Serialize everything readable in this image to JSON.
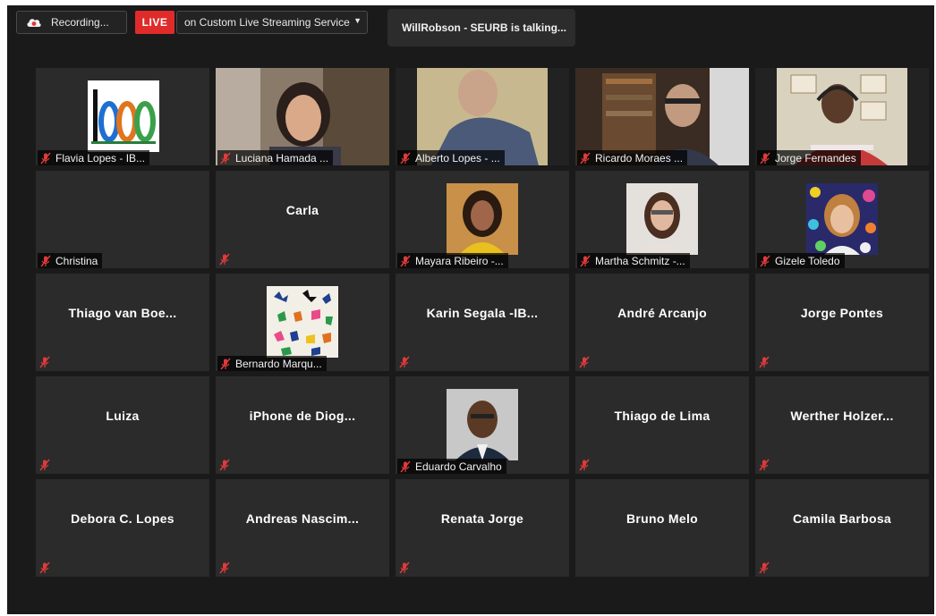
{
  "topbar": {
    "recording_label": "Recording...",
    "live_label": "LIVE",
    "stream_label": "on Custom Live Streaming Service",
    "talking_label": "WillRobson - SEURB is talking..."
  },
  "colors": {
    "live": "#e02b2b",
    "mic_muted": "#e03a3a",
    "tile_bg": "#2b2b2b",
    "window_bg": "#1a1a1a"
  },
  "participants": [
    {
      "name": "Flavia Lopes - IB...",
      "kind": "logo"
    },
    {
      "name": "Luciana Hamada ...",
      "kind": "video"
    },
    {
      "name": "Alberto Lopes  - ...",
      "kind": "video"
    },
    {
      "name": "Ricardo Moraes ...",
      "kind": "video"
    },
    {
      "name": "Jorge Fernandes",
      "kind": "video"
    },
    {
      "name": "Christina",
      "kind": "blank"
    },
    {
      "name": "Carla",
      "kind": "center"
    },
    {
      "name": "Mayara Ribeiro -...",
      "kind": "photo"
    },
    {
      "name": "Martha Schmitz -...",
      "kind": "photo"
    },
    {
      "name": "Gizele Toledo",
      "kind": "photo"
    },
    {
      "name": "Thiago van Boe...",
      "kind": "center"
    },
    {
      "name": "Bernardo Marqu...",
      "kind": "photo"
    },
    {
      "name": "Karin Segala -IB...",
      "kind": "center"
    },
    {
      "name": "André Arcanjo",
      "kind": "center"
    },
    {
      "name": "Jorge Pontes",
      "kind": "center"
    },
    {
      "name": "Luiza",
      "kind": "center"
    },
    {
      "name": "iPhone de Diog...",
      "kind": "center"
    },
    {
      "name": "Eduardo Carvalho",
      "kind": "photo"
    },
    {
      "name": "Thiago de Lima",
      "kind": "center"
    },
    {
      "name": "Werther  Holzer...",
      "kind": "center"
    },
    {
      "name": "Debora C. Lopes",
      "kind": "center"
    },
    {
      "name": "Andreas  Nascim...",
      "kind": "center"
    },
    {
      "name": "Renata Jorge",
      "kind": "center"
    },
    {
      "name": "Bruno Melo",
      "kind": "center"
    },
    {
      "name": "Camila Barbosa",
      "kind": "center"
    }
  ],
  "logo_text": "ibn"
}
